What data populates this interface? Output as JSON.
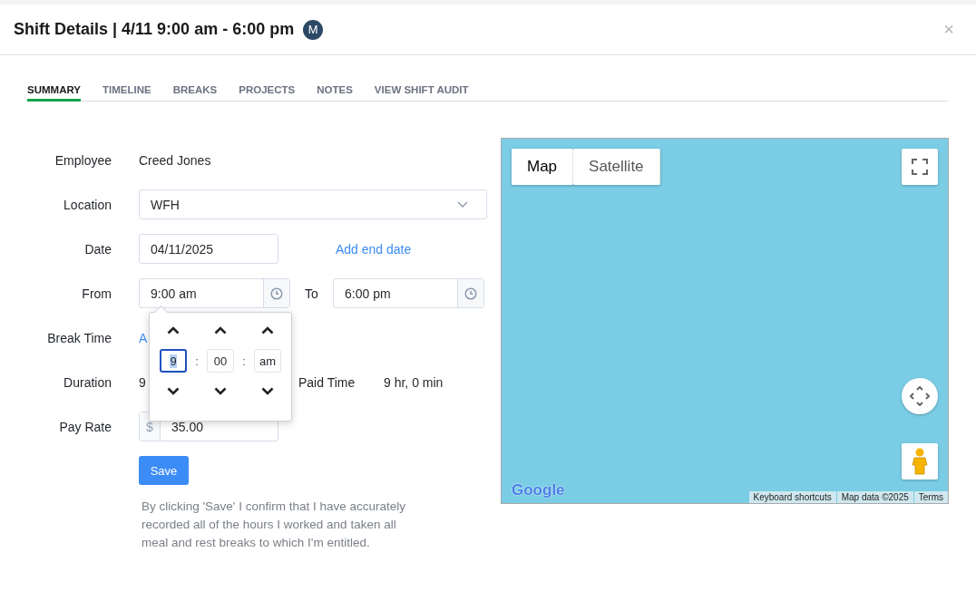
{
  "header": {
    "title": "Shift Details | 4/11 9:00 am - 6:00 pm",
    "avatar": "M",
    "close": "×"
  },
  "tabs": [
    {
      "label": "SUMMARY",
      "selected": true
    },
    {
      "label": "TIMELINE",
      "selected": false
    },
    {
      "label": "BREAKS",
      "selected": false
    },
    {
      "label": "PROJECTS",
      "selected": false
    },
    {
      "label": "NOTES",
      "selected": false
    },
    {
      "label": "VIEW SHIFT AUDIT",
      "selected": false
    }
  ],
  "form": {
    "employee": {
      "label": "Employee",
      "value": "Creed Jones"
    },
    "location": {
      "label": "Location",
      "value": "WFH"
    },
    "date": {
      "label": "Date",
      "value": "04/11/2025",
      "link": "Add end date"
    },
    "from": {
      "label": "From",
      "value": "9:00 am"
    },
    "to": {
      "label": "To",
      "value": "6:00 pm"
    },
    "break_time": {
      "label": "Break Time",
      "link": "A"
    },
    "duration": {
      "label": "Duration",
      "value": "9"
    },
    "paid_time": {
      "label": "Paid Time",
      "value": "9 hr, 0 min"
    },
    "pay_rate": {
      "label": "Pay Rate",
      "prefix": "$",
      "value": "35.00"
    },
    "save": "Save",
    "disclaimer": "By clicking 'Save' I confirm that I have accurately recorded all of the hours I worked and taken all meal and rest breaks to which I'm entitled."
  },
  "time_picker": {
    "fields": [
      {
        "value": "9",
        "selected": true
      },
      {
        "value": "00",
        "selected": false
      },
      {
        "value": "am",
        "selected": false
      }
    ],
    "separators": [
      ":",
      ":"
    ]
  },
  "map": {
    "types": [
      {
        "label": "Map",
        "selected": true
      },
      {
        "label": "Satellite",
        "selected": false
      }
    ],
    "logo": "Google",
    "attribution": [
      "Keyboard shortcuts",
      "Map data ©2025",
      "Terms"
    ]
  }
}
